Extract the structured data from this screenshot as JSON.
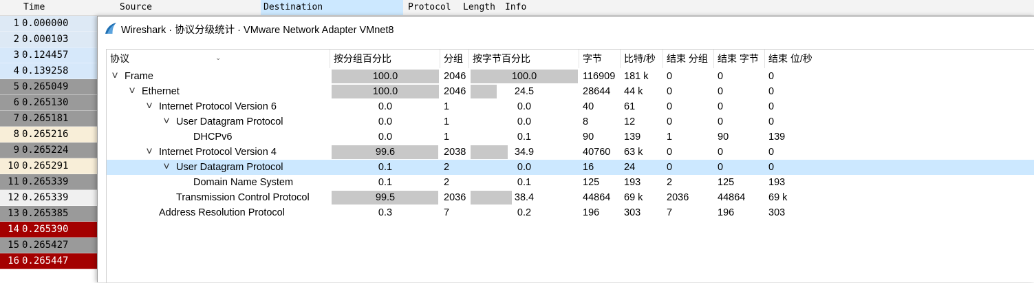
{
  "packet_list": {
    "headers": [
      "Time",
      "Source",
      "Destination",
      "Protocol",
      "Length",
      "Info"
    ],
    "rows": [
      {
        "no": "1",
        "time": "0.000000",
        "bg": "#dde9f5"
      },
      {
        "no": "2",
        "time": "0.000103",
        "bg": "#dde9f5"
      },
      {
        "no": "3",
        "time": "0.124457",
        "bg": "#d6e8fa"
      },
      {
        "no": "4",
        "time": "0.139258",
        "bg": "#d6e8fa"
      },
      {
        "no": "5",
        "time": "0.265049",
        "bg": "#9a9a9a"
      },
      {
        "no": "6",
        "time": "0.265130",
        "bg": "#9a9a9a"
      },
      {
        "no": "7",
        "time": "0.265181",
        "bg": "#9a9a9a"
      },
      {
        "no": "8",
        "time": "0.265216",
        "bg": "#f8eed8"
      },
      {
        "no": "9",
        "time": "0.265224",
        "bg": "#9a9a9a"
      },
      {
        "no": "10",
        "time": "0.265291",
        "bg": "#f8eed8"
      },
      {
        "no": "11",
        "time": "0.265339",
        "bg": "#9a9a9a"
      },
      {
        "no": "12",
        "time": "0.265339",
        "bg": "#f0f0f0"
      },
      {
        "no": "13",
        "time": "0.265385",
        "bg": "#9a9a9a"
      },
      {
        "no": "14",
        "time": "0.265390",
        "bg": "#a40000",
        "fg": "#ffffff"
      },
      {
        "no": "15",
        "time": "0.265427",
        "bg": "#9a9a9a"
      },
      {
        "no": "16",
        "time": "0.265447",
        "bg": "#a40000",
        "fg": "#ffffff"
      }
    ]
  },
  "dialog": {
    "title": "Wireshark · 协议分级统计 · VMware Network Adapter VMnet8",
    "icon": "wireshark-fin-icon",
    "columns": [
      "协议",
      "按分组百分比",
      "分组",
      "按字节百分比",
      "字节",
      "比特/秒",
      "结束 分组",
      "结束 字节",
      "结束 位/秒"
    ],
    "sort_indicator": "chevron-down-icon",
    "rows": [
      {
        "protocol": "Frame",
        "depth": 0,
        "expanded": true,
        "pkt_pct": "100.0",
        "pkt_frac": 1.0,
        "packets": "2046",
        "byte_pct": "100.0",
        "byte_frac": 1.0,
        "bytes": "116909",
        "bps": "181 k",
        "end_pkts": "0",
        "end_bytes": "0",
        "end_bps": "0"
      },
      {
        "protocol": "Ethernet",
        "depth": 1,
        "expanded": true,
        "pkt_pct": "100.0",
        "pkt_frac": 1.0,
        "packets": "2046",
        "byte_pct": "24.5",
        "byte_frac": 0.245,
        "bytes": "28644",
        "bps": "44 k",
        "end_pkts": "0",
        "end_bytes": "0",
        "end_bps": "0"
      },
      {
        "protocol": "Internet Protocol Version 6",
        "depth": 2,
        "expanded": true,
        "pkt_pct": "0.0",
        "pkt_frac": 0.0,
        "packets": "1",
        "byte_pct": "0.0",
        "byte_frac": 0.0,
        "bytes": "40",
        "bps": "61",
        "end_pkts": "0",
        "end_bytes": "0",
        "end_bps": "0"
      },
      {
        "protocol": "User Datagram Protocol",
        "depth": 3,
        "expanded": true,
        "pkt_pct": "0.0",
        "pkt_frac": 0.0,
        "packets": "1",
        "byte_pct": "0.0",
        "byte_frac": 0.0,
        "bytes": "8",
        "bps": "12",
        "end_pkts": "0",
        "end_bytes": "0",
        "end_bps": "0"
      },
      {
        "protocol": "DHCPv6",
        "depth": 4,
        "expanded": null,
        "pkt_pct": "0.0",
        "pkt_frac": 0.0,
        "packets": "1",
        "byte_pct": "0.1",
        "byte_frac": 0.001,
        "bytes": "90",
        "bps": "139",
        "end_pkts": "1",
        "end_bytes": "90",
        "end_bps": "139"
      },
      {
        "protocol": "Internet Protocol Version 4",
        "depth": 2,
        "expanded": true,
        "pkt_pct": "99.6",
        "pkt_frac": 0.996,
        "packets": "2038",
        "byte_pct": "34.9",
        "byte_frac": 0.349,
        "bytes": "40760",
        "bps": "63 k",
        "end_pkts": "0",
        "end_bytes": "0",
        "end_bps": "0"
      },
      {
        "protocol": "User Datagram Protocol",
        "depth": 3,
        "expanded": true,
        "selected": true,
        "pkt_pct": "0.1",
        "pkt_frac": 0.001,
        "packets": "2",
        "byte_pct": "0.0",
        "byte_frac": 0.0,
        "bytes": "16",
        "bps": "24",
        "end_pkts": "0",
        "end_bytes": "0",
        "end_bps": "0"
      },
      {
        "protocol": "Domain Name System",
        "depth": 4,
        "expanded": null,
        "pkt_pct": "0.1",
        "pkt_frac": 0.001,
        "packets": "2",
        "byte_pct": "0.1",
        "byte_frac": 0.001,
        "bytes": "125",
        "bps": "193",
        "end_pkts": "2",
        "end_bytes": "125",
        "end_bps": "193"
      },
      {
        "protocol": "Transmission Control Protocol",
        "depth": 3,
        "expanded": null,
        "pkt_pct": "99.5",
        "pkt_frac": 0.995,
        "packets": "2036",
        "byte_pct": "38.4",
        "byte_frac": 0.384,
        "bytes": "44864",
        "bps": "69 k",
        "end_pkts": "2036",
        "end_bytes": "44864",
        "end_bps": "69 k"
      },
      {
        "protocol": "Address Resolution Protocol",
        "depth": 2,
        "expanded": null,
        "pkt_pct": "0.3",
        "pkt_frac": 0.003,
        "packets": "7",
        "byte_pct": "0.2",
        "byte_frac": 0.002,
        "bytes": "196",
        "bps": "303",
        "end_pkts": "7",
        "end_bytes": "196",
        "end_bps": "303"
      }
    ]
  }
}
